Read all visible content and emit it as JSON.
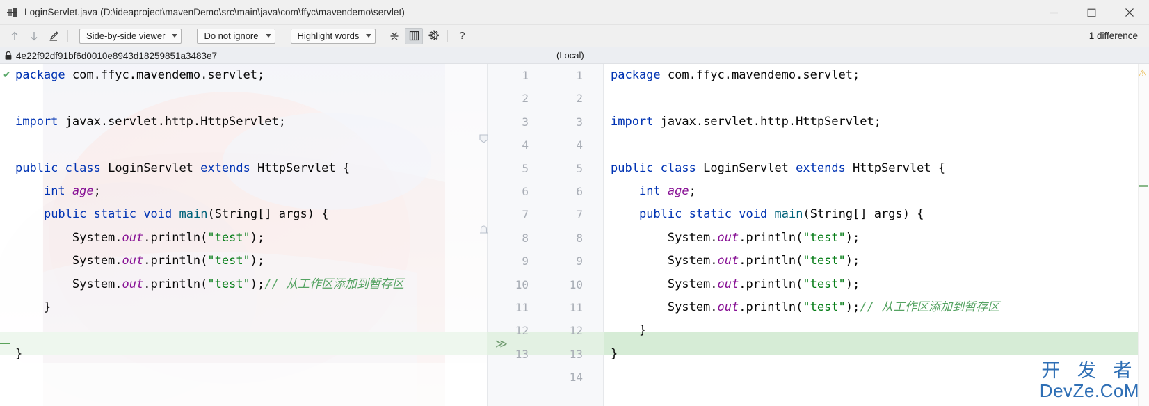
{
  "window": {
    "title": "LoginServlet.java (D:\\ideaproject\\mavenDemo\\src\\main\\java\\com\\ffyc\\mavendemo\\servlet)",
    "icon": "diff-window-icon",
    "minimize_label": "Minimize",
    "maximize_label": "Maximize",
    "close_label": "Close"
  },
  "toolbar": {
    "prev_diff_label": "Previous difference",
    "next_diff_label": "Next difference",
    "edit_label": "Edit",
    "viewer_mode": "Side-by-side viewer",
    "ignore_mode": "Do not ignore",
    "highlight_mode": "Highlight words",
    "collapse_label": "Collapse unchanged fragments",
    "columns_label": "Synchronize scrolling",
    "settings_label": "Settings",
    "help_label": "?",
    "difference_count": "1 difference"
  },
  "revision": {
    "left_hash": "4e22f92df91bf6d0010e8943d18259851a3483e7",
    "left_lock_icon": "lock-icon",
    "right_label": "(Local)"
  },
  "editor": {
    "left_line_numbers": [
      "1",
      "2",
      "3",
      "4",
      "5",
      "6",
      "7",
      "8",
      "9",
      "10",
      "11",
      "12",
      "13"
    ],
    "right_line_numbers": [
      "1",
      "2",
      "3",
      "4",
      "5",
      "6",
      "7",
      "8",
      "9",
      "10",
      "11",
      "12",
      "13",
      "14"
    ],
    "highlight_marker": "≫",
    "left_lines": [
      {
        "n": 1,
        "segments": [
          {
            "t": "package",
            "c": "kw"
          },
          {
            "t": " com.ffyc.mavendemo.servlet;",
            "c": "plain"
          }
        ]
      },
      {
        "n": 2,
        "segments": []
      },
      {
        "n": 3,
        "segments": [
          {
            "t": "import",
            "c": "kw"
          },
          {
            "t": " javax.servlet.http.HttpServlet;",
            "c": "plain"
          }
        ]
      },
      {
        "n": 4,
        "segments": []
      },
      {
        "n": 5,
        "segments": [
          {
            "t": "public",
            "c": "kw"
          },
          {
            "t": " ",
            "c": "plain"
          },
          {
            "t": "class",
            "c": "kw"
          },
          {
            "t": " LoginServlet ",
            "c": "plain"
          },
          {
            "t": "extends",
            "c": "kw"
          },
          {
            "t": " HttpServlet {",
            "c": "plain"
          }
        ]
      },
      {
        "n": 6,
        "segments": [
          {
            "t": "    ",
            "c": "plain"
          },
          {
            "t": "int",
            "c": "kw"
          },
          {
            "t": " ",
            "c": "plain"
          },
          {
            "t": "age",
            "c": "fld"
          },
          {
            "t": ";",
            "c": "plain"
          }
        ]
      },
      {
        "n": 7,
        "segments": [
          {
            "t": "    ",
            "c": "plain"
          },
          {
            "t": "public",
            "c": "kw"
          },
          {
            "t": " ",
            "c": "plain"
          },
          {
            "t": "static",
            "c": "kw"
          },
          {
            "t": " ",
            "c": "plain"
          },
          {
            "t": "void",
            "c": "kw"
          },
          {
            "t": " ",
            "c": "plain"
          },
          {
            "t": "main",
            "c": "mth"
          },
          {
            "t": "(String[] args) {",
            "c": "plain"
          }
        ]
      },
      {
        "n": 8,
        "segments": [
          {
            "t": "        System.",
            "c": "plain"
          },
          {
            "t": "out",
            "c": "fld"
          },
          {
            "t": ".println(",
            "c": "plain"
          },
          {
            "t": "\"test\"",
            "c": "str"
          },
          {
            "t": ");",
            "c": "plain"
          }
        ]
      },
      {
        "n": 9,
        "segments": [
          {
            "t": "        System.",
            "c": "plain"
          },
          {
            "t": "out",
            "c": "fld"
          },
          {
            "t": ".println(",
            "c": "plain"
          },
          {
            "t": "\"test\"",
            "c": "str"
          },
          {
            "t": ");",
            "c": "plain"
          }
        ]
      },
      {
        "n": 10,
        "segments": [
          {
            "t": "        System.",
            "c": "plain"
          },
          {
            "t": "out",
            "c": "fld"
          },
          {
            "t": ".println(",
            "c": "plain"
          },
          {
            "t": "\"test\"",
            "c": "str"
          },
          {
            "t": ");",
            "c": "plain"
          },
          {
            "t": "// 从工作区添加到暂存区",
            "c": "cmtg"
          }
        ]
      },
      {
        "n": 11,
        "segments": [
          {
            "t": "    }",
            "c": "plain"
          }
        ]
      },
      {
        "n": 12,
        "segments": []
      },
      {
        "n": 13,
        "segments": [
          {
            "t": "}",
            "c": "plain"
          }
        ]
      }
    ],
    "right_lines": [
      {
        "n": 1,
        "segments": [
          {
            "t": "package",
            "c": "kw"
          },
          {
            "t": " com.ffyc.mavendemo.servlet;",
            "c": "plain"
          }
        ]
      },
      {
        "n": 2,
        "segments": []
      },
      {
        "n": 3,
        "segments": [
          {
            "t": "import",
            "c": "kw"
          },
          {
            "t": " javax.servlet.http.HttpServlet;",
            "c": "plain"
          }
        ]
      },
      {
        "n": 4,
        "segments": []
      },
      {
        "n": 5,
        "segments": [
          {
            "t": "public",
            "c": "kw"
          },
          {
            "t": " ",
            "c": "plain"
          },
          {
            "t": "class",
            "c": "kw"
          },
          {
            "t": " LoginServlet ",
            "c": "plain"
          },
          {
            "t": "extends",
            "c": "kw"
          },
          {
            "t": " HttpServlet {",
            "c": "plain"
          }
        ]
      },
      {
        "n": 6,
        "segments": [
          {
            "t": "    ",
            "c": "plain"
          },
          {
            "t": "int",
            "c": "kw"
          },
          {
            "t": " ",
            "c": "plain"
          },
          {
            "t": "age",
            "c": "fld"
          },
          {
            "t": ";",
            "c": "plain"
          }
        ]
      },
      {
        "n": 7,
        "segments": [
          {
            "t": "    ",
            "c": "plain"
          },
          {
            "t": "public",
            "c": "kw"
          },
          {
            "t": " ",
            "c": "plain"
          },
          {
            "t": "static",
            "c": "kw"
          },
          {
            "t": " ",
            "c": "plain"
          },
          {
            "t": "void",
            "c": "kw"
          },
          {
            "t": " ",
            "c": "plain"
          },
          {
            "t": "main",
            "c": "mth"
          },
          {
            "t": "(String[] args) {",
            "c": "plain"
          }
        ]
      },
      {
        "n": 8,
        "segments": [
          {
            "t": "        System.",
            "c": "plain"
          },
          {
            "t": "out",
            "c": "fld"
          },
          {
            "t": ".println(",
            "c": "plain"
          },
          {
            "t": "\"test\"",
            "c": "str"
          },
          {
            "t": ");",
            "c": "plain"
          }
        ]
      },
      {
        "n": 9,
        "segments": [
          {
            "t": "        System.",
            "c": "plain"
          },
          {
            "t": "out",
            "c": "fld"
          },
          {
            "t": ".println(",
            "c": "plain"
          },
          {
            "t": "\"test\"",
            "c": "str"
          },
          {
            "t": ");",
            "c": "plain"
          }
        ]
      },
      {
        "n": 10,
        "segments": [
          {
            "t": "        System.",
            "c": "plain"
          },
          {
            "t": "out",
            "c": "fld"
          },
          {
            "t": ".println(",
            "c": "plain"
          },
          {
            "t": "\"test\"",
            "c": "str"
          },
          {
            "t": ");",
            "c": "plain"
          }
        ]
      },
      {
        "n": 11,
        "segments": [
          {
            "t": "        System.",
            "c": "plain"
          },
          {
            "t": "out",
            "c": "fld"
          },
          {
            "t": ".println(",
            "c": "plain"
          },
          {
            "t": "\"test\"",
            "c": "str"
          },
          {
            "t": ");",
            "c": "plain"
          },
          {
            "t": "// 从工作区添加到暂存区",
            "c": "cmtg"
          }
        ]
      },
      {
        "n": 12,
        "segments": [
          {
            "t": "    }",
            "c": "plain"
          }
        ]
      },
      {
        "n": 13,
        "segments": [
          {
            "t": "}",
            "c": "plain"
          }
        ]
      },
      {
        "n": 14,
        "segments": []
      }
    ]
  },
  "watermark": {
    "line1": "开 发 者",
    "line2": "DevZe.CoM",
    "color": "#2f6fb5"
  },
  "colors": {
    "added_line_strong": "#d6ecd6",
    "added_line_soft": "#eef7ee",
    "keyword": "#0033b3",
    "string": "#067d17",
    "field": "#871094",
    "method": "#00627a",
    "comment": "#55a362",
    "toolbar_bg": "#f0f0f0",
    "revbar_bg": "#eceef2"
  }
}
